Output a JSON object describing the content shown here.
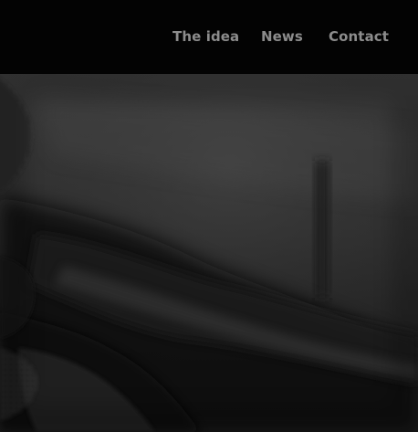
{
  "nav": {
    "items": [
      {
        "label": "The idea"
      },
      {
        "label": "News"
      },
      {
        "label": "Contact"
      }
    ]
  },
  "hero": {
    "image": "blurred-grayscale-photo",
    "colors": {
      "topbar": "#030303",
      "nav_text": "#8c8c8c"
    }
  }
}
